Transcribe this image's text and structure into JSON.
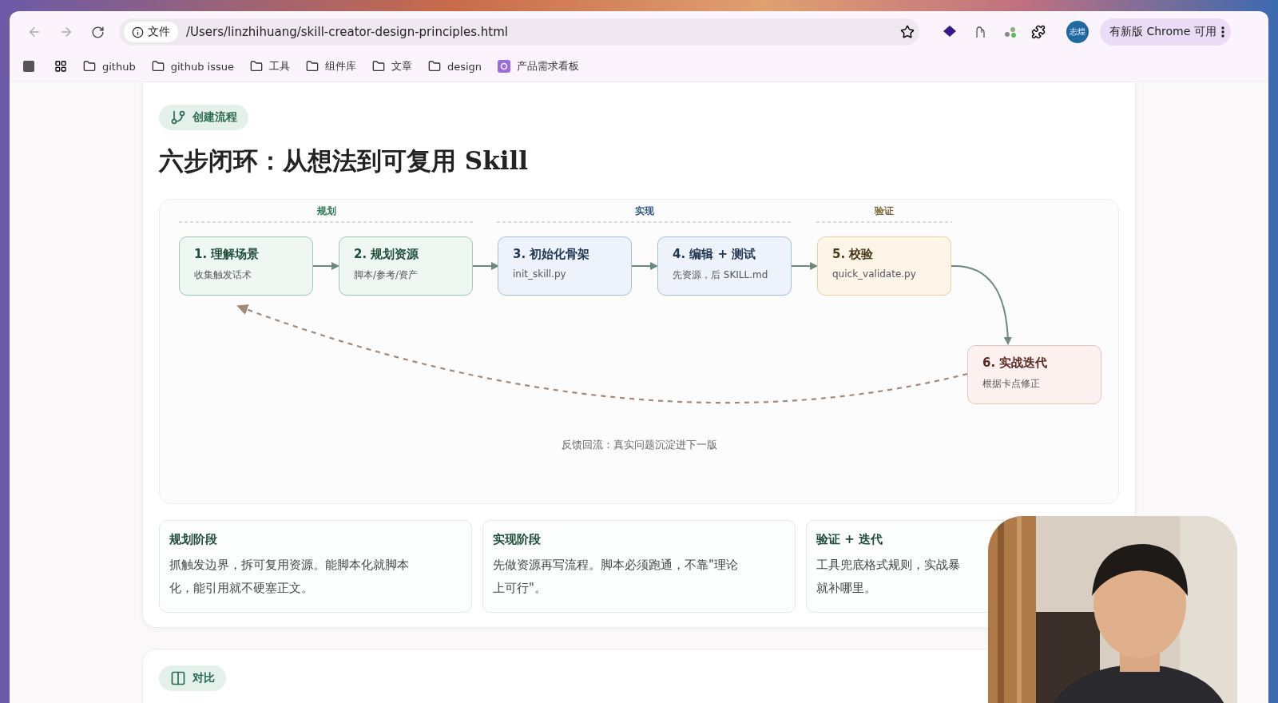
{
  "browser": {
    "security_chip": "文件",
    "url": "/Users/linzhihuang/skill-creator-design-principles.html",
    "profile_badge": "志煌",
    "update_button": "有新版 Chrome 可用"
  },
  "bookmarks": [
    {
      "label": "github",
      "kind": "folder"
    },
    {
      "label": "github issue",
      "kind": "folder"
    },
    {
      "label": "工具",
      "kind": "folder"
    },
    {
      "label": "组件库",
      "kind": "folder"
    },
    {
      "label": "文章",
      "kind": "folder"
    },
    {
      "label": "design",
      "kind": "folder"
    },
    {
      "label": "产品需求看板",
      "kind": "app"
    }
  ],
  "section": {
    "badge": "创建流程",
    "title": "六步闭环：从想法到可复用 Skill"
  },
  "diagram": {
    "phases": [
      {
        "label": "规划",
        "color": "#2f7a5a"
      },
      {
        "label": "实现",
        "color": "#2f5a8a"
      },
      {
        "label": "验证",
        "color": "#7a6a3a"
      }
    ],
    "steps": [
      {
        "title": "1. 理解场景",
        "subtitle": "收集触发话术",
        "color": "#9fcbb5"
      },
      {
        "title": "2. 规划资源",
        "subtitle": "脚本/参考/资产",
        "color": "#9fcbb5"
      },
      {
        "title": "3. 初始化骨架",
        "subtitle": "init_skill.py",
        "color": "#a9bce0"
      },
      {
        "title": "4. 编辑 + 测试",
        "subtitle": "先资源，后 SKILL.md",
        "color": "#a9bce0"
      },
      {
        "title": "5. 校验",
        "subtitle": "quick_validate.py",
        "color": "#e6d1a8"
      },
      {
        "title": "6. 实战迭代",
        "subtitle": "根据卡点修正",
        "color": "#e6c5bf"
      }
    ],
    "feedback": "反馈回流：真实问题沉淀进下一版"
  },
  "cards": [
    {
      "title": "规划阶段",
      "lines": [
        "抓触发边界，拆可复用资源。能脚本化就脚本",
        "化，能引用就不硬塞正文。"
      ]
    },
    {
      "title": "实现阶段",
      "lines": [
        "先做资源再写流程。脚本必须跑通，不靠\"理论",
        "上可行\"。"
      ]
    },
    {
      "title": "验证 + 迭代",
      "lines": [
        "工具兜底格式规则，实战暴",
        "就补哪里。"
      ]
    }
  ],
  "next_section": {
    "badge": "对比"
  }
}
